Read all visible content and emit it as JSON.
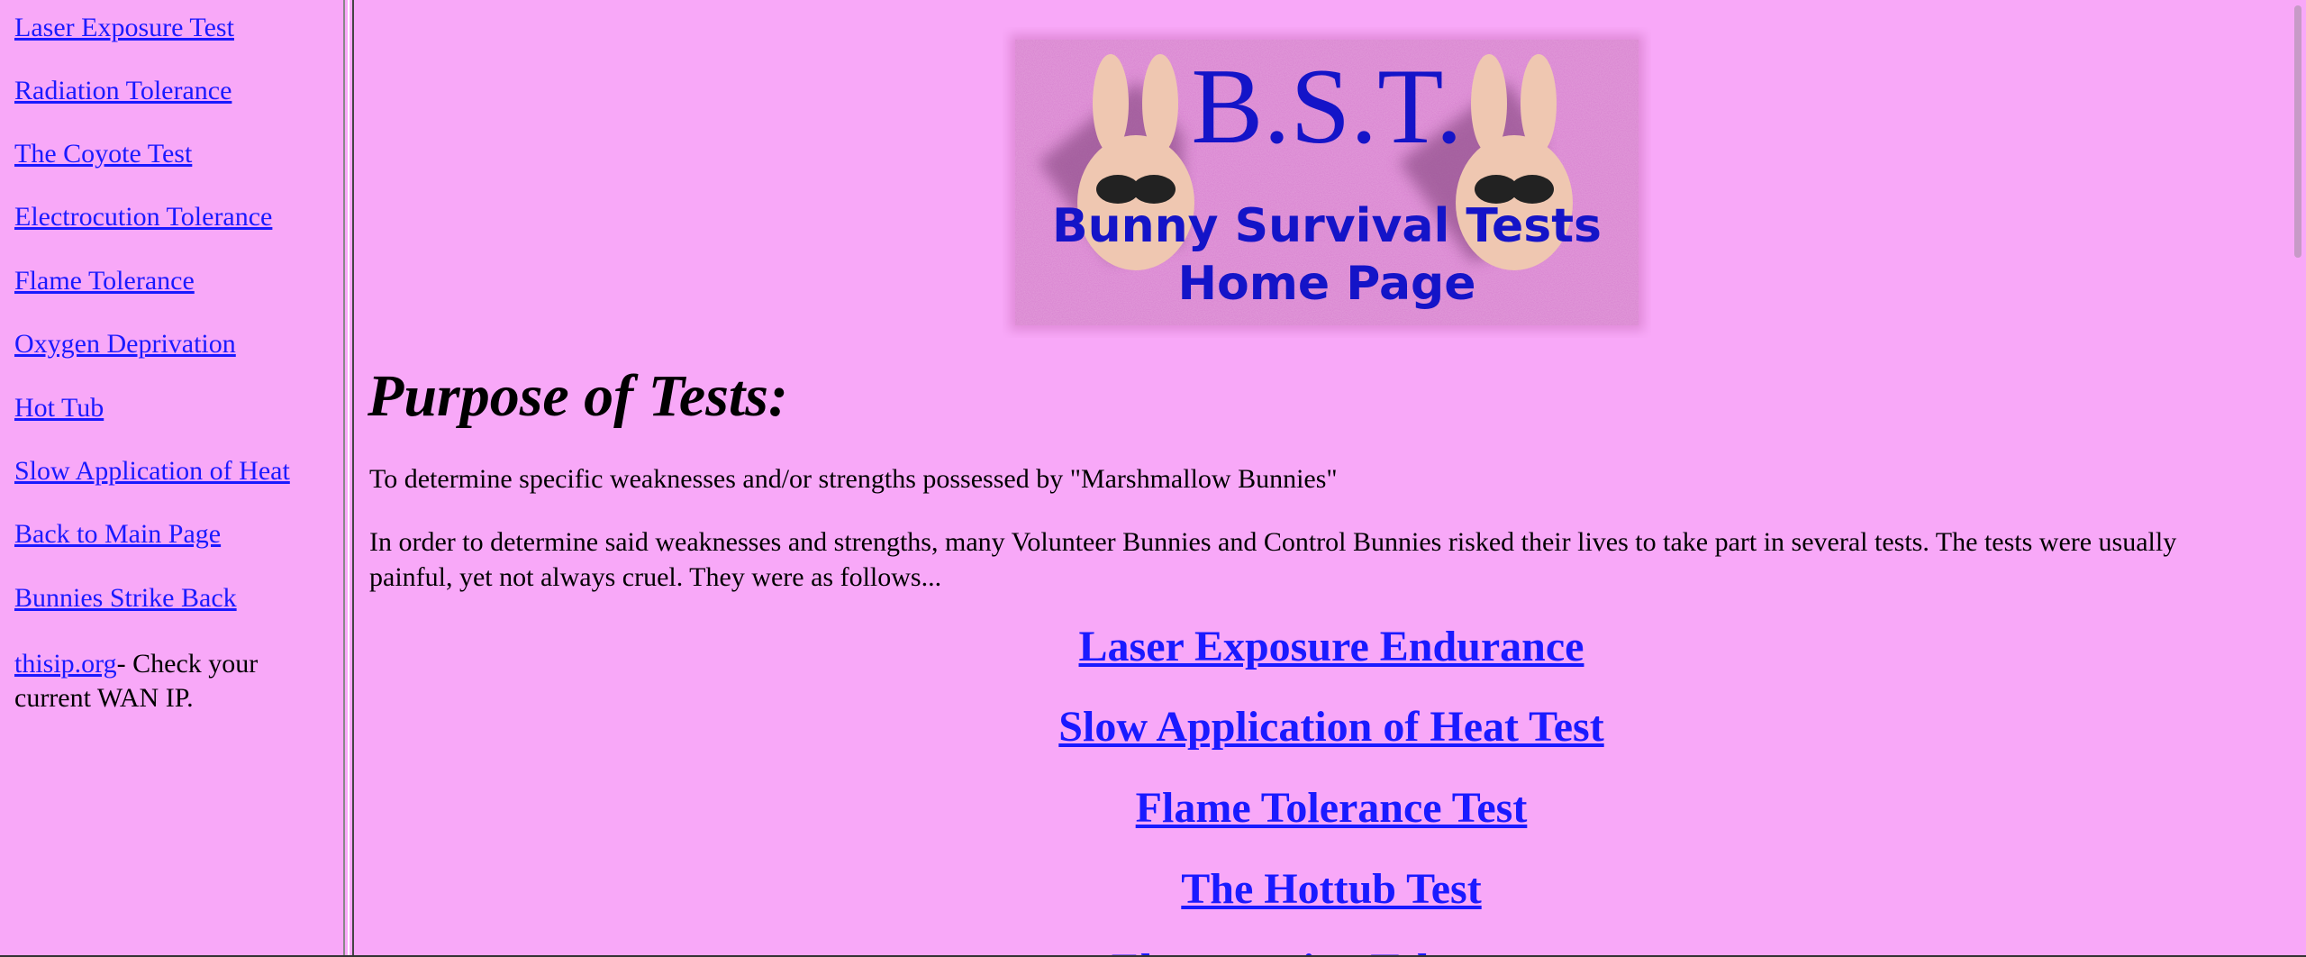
{
  "nav": {
    "links": [
      "Laser Exposure Test",
      "Radiation Tolerance",
      "The Coyote Test",
      "Electrocution Tolerance",
      "Flame Tolerance",
      "Oxygen Deprivation",
      "Hot Tub",
      "Slow Application of Heat",
      "Back to Main Page",
      "Bunnies Strike Back"
    ],
    "info_link": "thisip.org",
    "info_text": "- Check your current WAN IP."
  },
  "banner": {
    "title": "B.S.T.",
    "line1": "Bunny Survival Tests",
    "line2": "Home Page"
  },
  "main": {
    "heading": "Purpose of Tests:",
    "para1": "To determine specific weaknesses and/or strengths possessed by \"Marshmallow Bunnies\"",
    "para2": "In order to determine said weaknesses and strengths, many Volunteer Bunnies and Control Bunnies risked their lives to take part in several tests. The tests were usually painful, yet not always cruel. They were as follows...",
    "tests": [
      "Laser Exposure Endurance",
      "Slow Application of Heat Test",
      "Flame Tolerance Test",
      "The Hottub Test",
      "Electrocution Tolerance"
    ]
  },
  "colors": {
    "background": "#f8a8f8",
    "link": "#1a1aff"
  }
}
